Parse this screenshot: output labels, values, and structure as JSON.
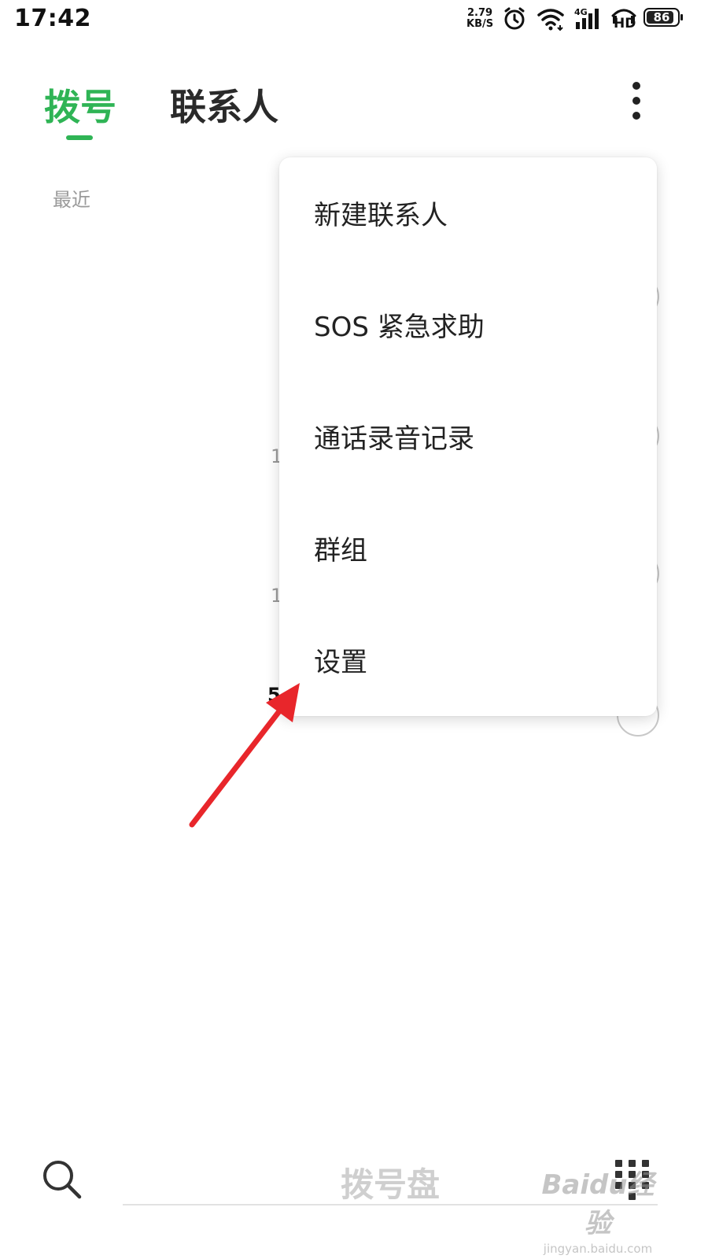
{
  "status_bar": {
    "time": "17:42",
    "net_speed_value": "2.79",
    "net_speed_unit": "KB/S",
    "network_type": "4G",
    "hd_label": "HD",
    "battery_level": "86",
    "icons": [
      "alarm-icon",
      "wifi-icon",
      "signal-icon",
      "hd-icon",
      "battery-icon"
    ]
  },
  "header": {
    "tabs": [
      {
        "label": "拨号",
        "active": true
      },
      {
        "label": "联系人",
        "active": false
      }
    ],
    "more_icon": "more-vertical-icon",
    "accent_color": "#2fb455"
  },
  "recent": {
    "section_label": "最近",
    "peek_numbers": [
      "1",
      "1",
      "5"
    ]
  },
  "menu": {
    "items": [
      {
        "label": "新建联系人"
      },
      {
        "label": "SOS 紧急求助"
      },
      {
        "label": "通话录音记录"
      },
      {
        "label": "群组"
      },
      {
        "label": "设置"
      }
    ]
  },
  "bottom": {
    "search_icon": "search-icon",
    "dial_placeholder": "拨号盘",
    "keypad_icon": "keypad-icon"
  },
  "annotation": {
    "arrow_color": "#e8262b"
  },
  "watermark": {
    "main": "Baidu经验",
    "sub": "jingyan.baidu.com"
  }
}
